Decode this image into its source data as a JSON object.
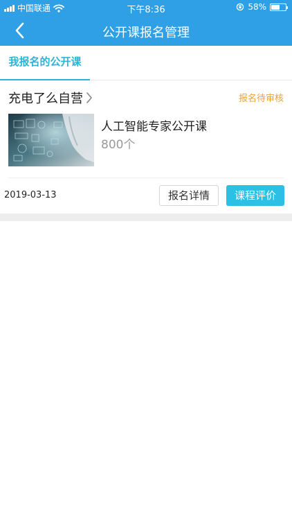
{
  "status_bar": {
    "carrier": "中国联通",
    "time": "下午8:36",
    "battery_percent": "58%",
    "battery_level": 0.58
  },
  "nav": {
    "title": "公开课报名管理",
    "back_icon": "back-chevron-icon"
  },
  "tabs": [
    {
      "label": "我报名的公开课",
      "active": true
    }
  ],
  "order": {
    "store_name": "充电了么自营",
    "status": "报名待审核",
    "course_title": "人工智能专家公开课",
    "course_count": "800个",
    "date": "2019-03-13",
    "detail_button": "报名详情",
    "review_button": "课程评价"
  },
  "colors": {
    "header_blue": "#2f9fe6",
    "tab_accent": "#2bb4d6",
    "status_orange": "#e9a23b",
    "review_button": "#2bc0e4"
  }
}
